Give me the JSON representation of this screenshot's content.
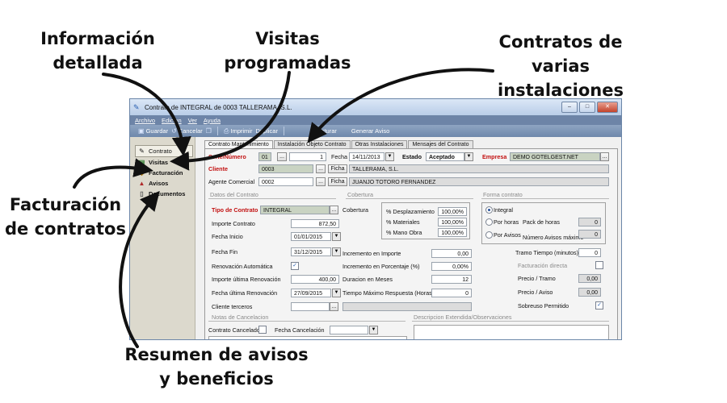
{
  "callouts": {
    "informacion": "Información detallada",
    "visitas": "Visitas programadas",
    "contratos": "Contratos de varias instalaciones",
    "facturacion": "Facturación de contratos",
    "resumen": "Resumen de avisos y beneficios"
  },
  "window": {
    "title": "Contrato de INTEGRAL de 0003 TALLERAMA, S.L.",
    "controls": {
      "minimize": "–",
      "maximize": "□",
      "close": "✕"
    }
  },
  "menu": [
    "Archivo",
    "Edicion",
    "Ver",
    "Ayuda"
  ],
  "toolbar": {
    "guardar": "Guardar",
    "cancelar": "Cancelar",
    "imprimir": "Imprimir",
    "duplicar": "Duplicar",
    "facturar": "Facturar",
    "generar_aviso": "Generar Aviso"
  },
  "sidebar": [
    {
      "label": "Contrato",
      "icon": "pen-icon"
    },
    {
      "label": "Visitas",
      "icon": "visits-icon"
    },
    {
      "label": "Facturación",
      "icon": "invoice-icon"
    },
    {
      "label": "Avisos",
      "icon": "alert-icon"
    },
    {
      "label": "Documentos",
      "icon": "document-icon"
    }
  ],
  "tabs": [
    "Contrato Mantenimiento",
    "Instalación Objeto Contrato",
    "Otras Instalaciones",
    "Mensajes del Contrato"
  ],
  "form": {
    "serie_label": "Serie/Número",
    "serie_value": "01",
    "numero_value": "1",
    "fecha_label": "Fecha",
    "fecha_value": "14/11/2013",
    "estado_label": "Estado",
    "estado_value": "Aceptado",
    "empresa_label": "Empresa",
    "empresa_value": "DEMO GOTELGEST.NET",
    "cliente_label": "Cliente",
    "cliente_code": "0003",
    "cliente_name": "TALLERAMA, S.L.",
    "agente_label": "Agente Comercial",
    "agente_code": "0002",
    "agente_name": "JUANJO TOTORO FERNANDEZ",
    "ficha": "Ficha",
    "dots": "...",
    "datos_group": "Datos del Contrato",
    "cobertura_group": "Cobertura",
    "forma_group": "Forma contrato",
    "tipo_label": "Tipo de Contrato",
    "tipo_value": "INTEGRAL",
    "importe_label": "Importe Contrato",
    "importe_value": "872,50",
    "inicio_label": "Fecha Inicio",
    "inicio_value": "01/01/2015",
    "fin_label": "Fecha Fin",
    "fin_value": "31/12/2015",
    "renov_label": "Renovación Automática",
    "importe_ult_label": "Importe última Renovación",
    "importe_ult_value": "400,00",
    "fecha_ult_label": "Fecha última Renovación",
    "fecha_ult_value": "27/09/2015",
    "cliente_terceros_label": "Cliente terceros",
    "cobertura_label": "Cobertura",
    "desplazamiento_label": "% Desplazamiento",
    "desplazamiento_value": "100,00%",
    "materiales_label": "% Materiales",
    "materiales_value": "100,00%",
    "manoobra_label": "% Mano Obra",
    "manoobra_value": "100,00%",
    "inc_importe_label": "Incremento en Importe",
    "inc_importe_value": "0,00",
    "inc_porc_label": "Incremento en Porcentaje (%)",
    "inc_porc_value": "0,00%",
    "duracion_label": "Duracion en Meses",
    "duracion_value": "12",
    "tiempo_max_label": "Tiempo Máximo Respuesta (Horas)",
    "tiempo_max_value": "0",
    "integral_label": "Integral",
    "porhoras_label": "Por horas",
    "poravisos_label": "Por Avisos",
    "pack_label": "Pack de horas",
    "pack_value": "0",
    "num_avisos_label": "Número Avisos máximo",
    "num_avisos_value": "0",
    "tramo_label": "Tramo Tiempo (minutos)",
    "tramo_value": "0",
    "fact_directa_label": "Facturación directa",
    "precio_tramo_label": "Precio / Tramo",
    "precio_tramo_value": "0,00",
    "precio_aviso_label": "Precio / Aviso",
    "precio_aviso_value": "0,00",
    "sobreuso_label": "Sobreuso Permitido",
    "notas_group": "Notas de Cancelacion",
    "cancelado_label": "Contrato Cancelado",
    "fecha_canc_label": "Fecha Cancelación",
    "descripcion_group": "Descripcion Extendida/Observaciones"
  },
  "colors": {
    "title_blue": "#c9d9ef",
    "menubar": "#6d84a7",
    "sidebar": "#dcd9cd",
    "required_red": "#c21010"
  }
}
